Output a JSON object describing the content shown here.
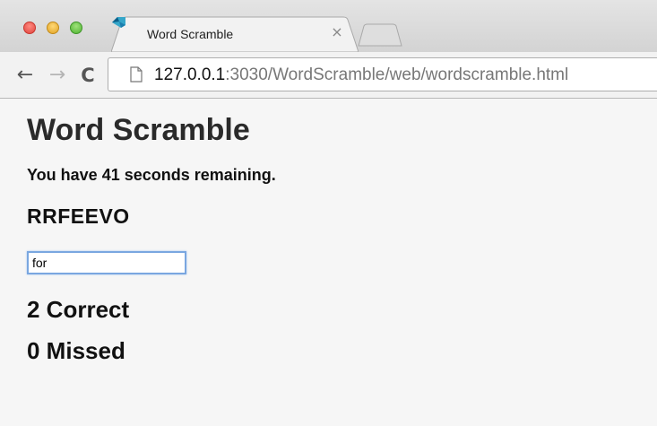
{
  "browser": {
    "tab": {
      "title": "Word Scramble",
      "close_glyph": "×",
      "favicon": "dart-icon"
    },
    "new_tab_icon": "new-tab-icon",
    "toolbar": {
      "back_glyph": "←",
      "forward_glyph": "→",
      "reload_glyph": "C",
      "url_host": "127.0.0.1",
      "url_rest": ":3030/WordScramble/web/wordscramble.html"
    }
  },
  "page": {
    "title": "Word Scramble",
    "timer_text": "You have 41 seconds remaining.",
    "scrambled_word": "RRFEEVO",
    "guess_value": "for",
    "correct_text": "2 Correct",
    "missed_text": "0 Missed"
  },
  "colors": {
    "close": "#e0443e",
    "minimize": "#e1a324",
    "maximize": "#4fb332",
    "input_focus": "#7aa7e0"
  }
}
